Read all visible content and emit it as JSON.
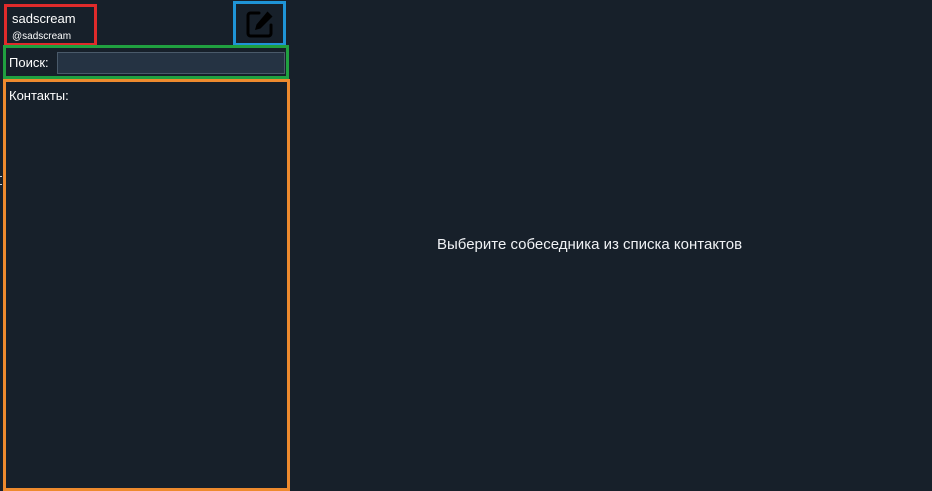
{
  "profile": {
    "name": "sadscream",
    "handle": "@sadscream"
  },
  "toolbar": {
    "edit_icon": "edit-square-icon"
  },
  "search": {
    "label": "Поиск:",
    "value": "",
    "placeholder": ""
  },
  "contacts": {
    "title": "Контакты:",
    "items": []
  },
  "main": {
    "placeholder": "Выберите собеседника из списка контактов"
  },
  "colors": {
    "background": "#17202a",
    "input_background": "#253343",
    "profile_border": "#e02b2b",
    "edit_border": "#1f94d6",
    "search_border": "#20a040",
    "contacts_border": "#ee8a2e"
  }
}
